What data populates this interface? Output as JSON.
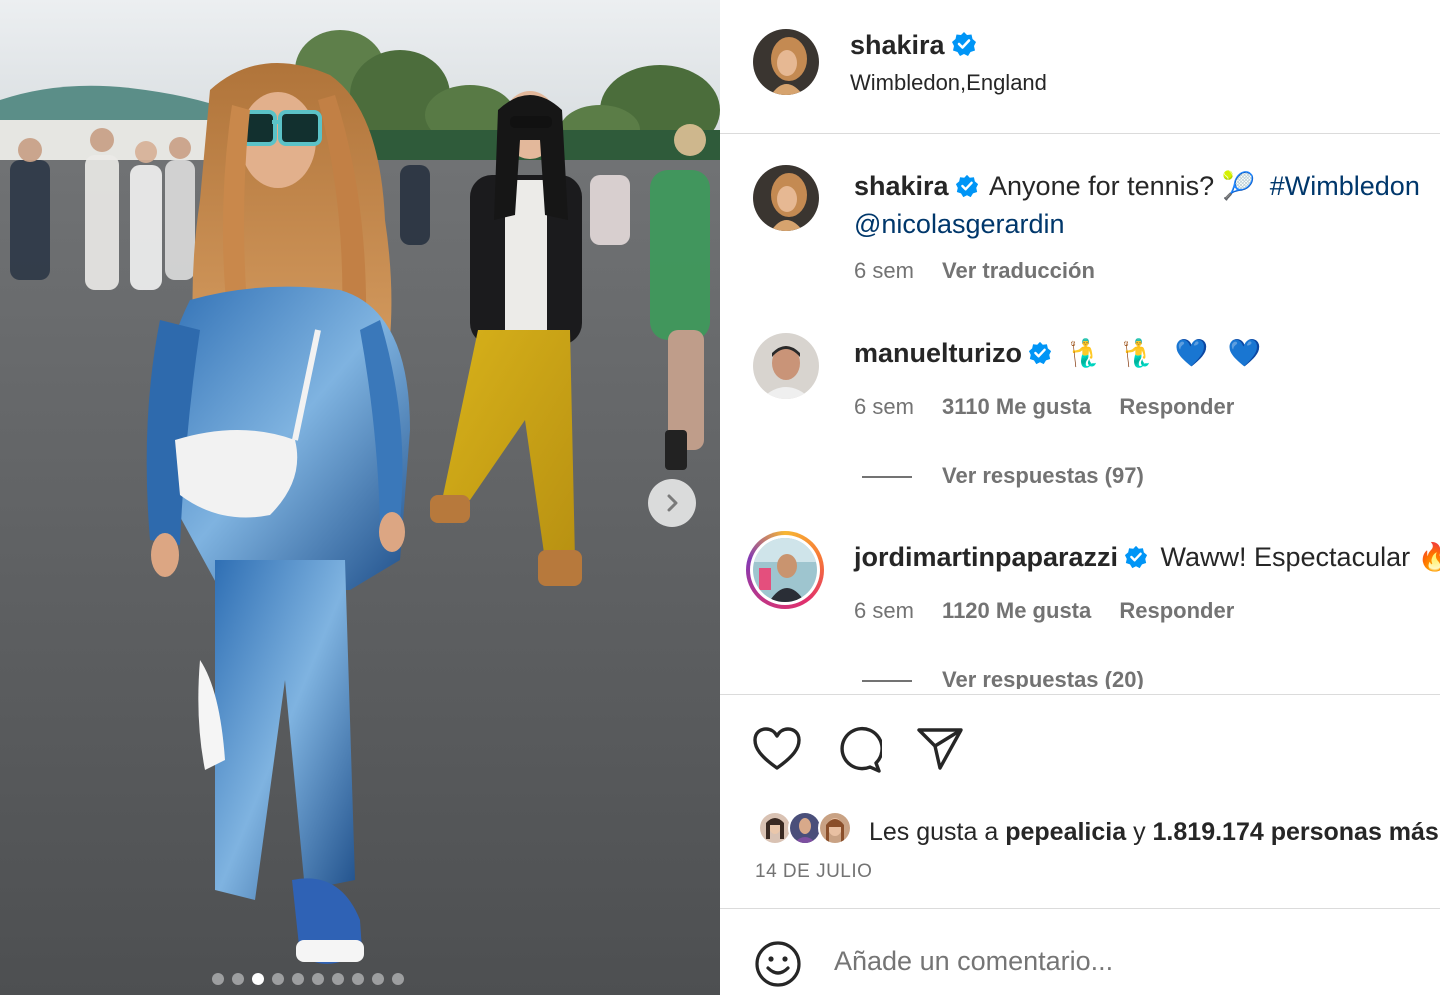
{
  "post": {
    "author": "shakira",
    "location": "Wimbledon,England",
    "caption_text": "Anyone for tennis? 🎾",
    "caption_hashtag": "#Wimbledon",
    "caption_mention": "@nicolasgerardin",
    "caption_age": "6 sem",
    "translate_label": "Ver traducción",
    "carousel": {
      "slide_count": 10,
      "active_index": 2
    }
  },
  "comments": [
    {
      "username": "manuelturizo",
      "text": "🧜‍♂️ 🧜‍♂️ 💙 💙",
      "age": "6 sem",
      "likes": "3110 Me gusta",
      "reply_label": "Responder",
      "view_replies": "Ver respuestas (97)"
    },
    {
      "username": "jordimartinpaparazzi",
      "text": "Waww! Espectacular 🔥",
      "age": "6 sem",
      "likes": "1120 Me gusta",
      "reply_label": "Responder",
      "view_replies": "Ver respuestas (20)"
    }
  ],
  "likes_summary": {
    "prefix": "Les gusta a",
    "user": "pepealicia",
    "joiner": "y",
    "count_text": "1.819.174 personas más"
  },
  "date": "14 DE JULIO",
  "composer": {
    "placeholder": "Añade un comentario..."
  },
  "icons": {
    "like": "heart-icon",
    "comment": "comment-icon",
    "share": "send-icon",
    "emoji": "emoji-icon",
    "next": "chevron-right-icon",
    "verified": "verified-badge-icon"
  },
  "colors": {
    "verified": "#0095f6",
    "link": "#00376b",
    "muted": "#737373",
    "story_ring": "#e1306c"
  }
}
